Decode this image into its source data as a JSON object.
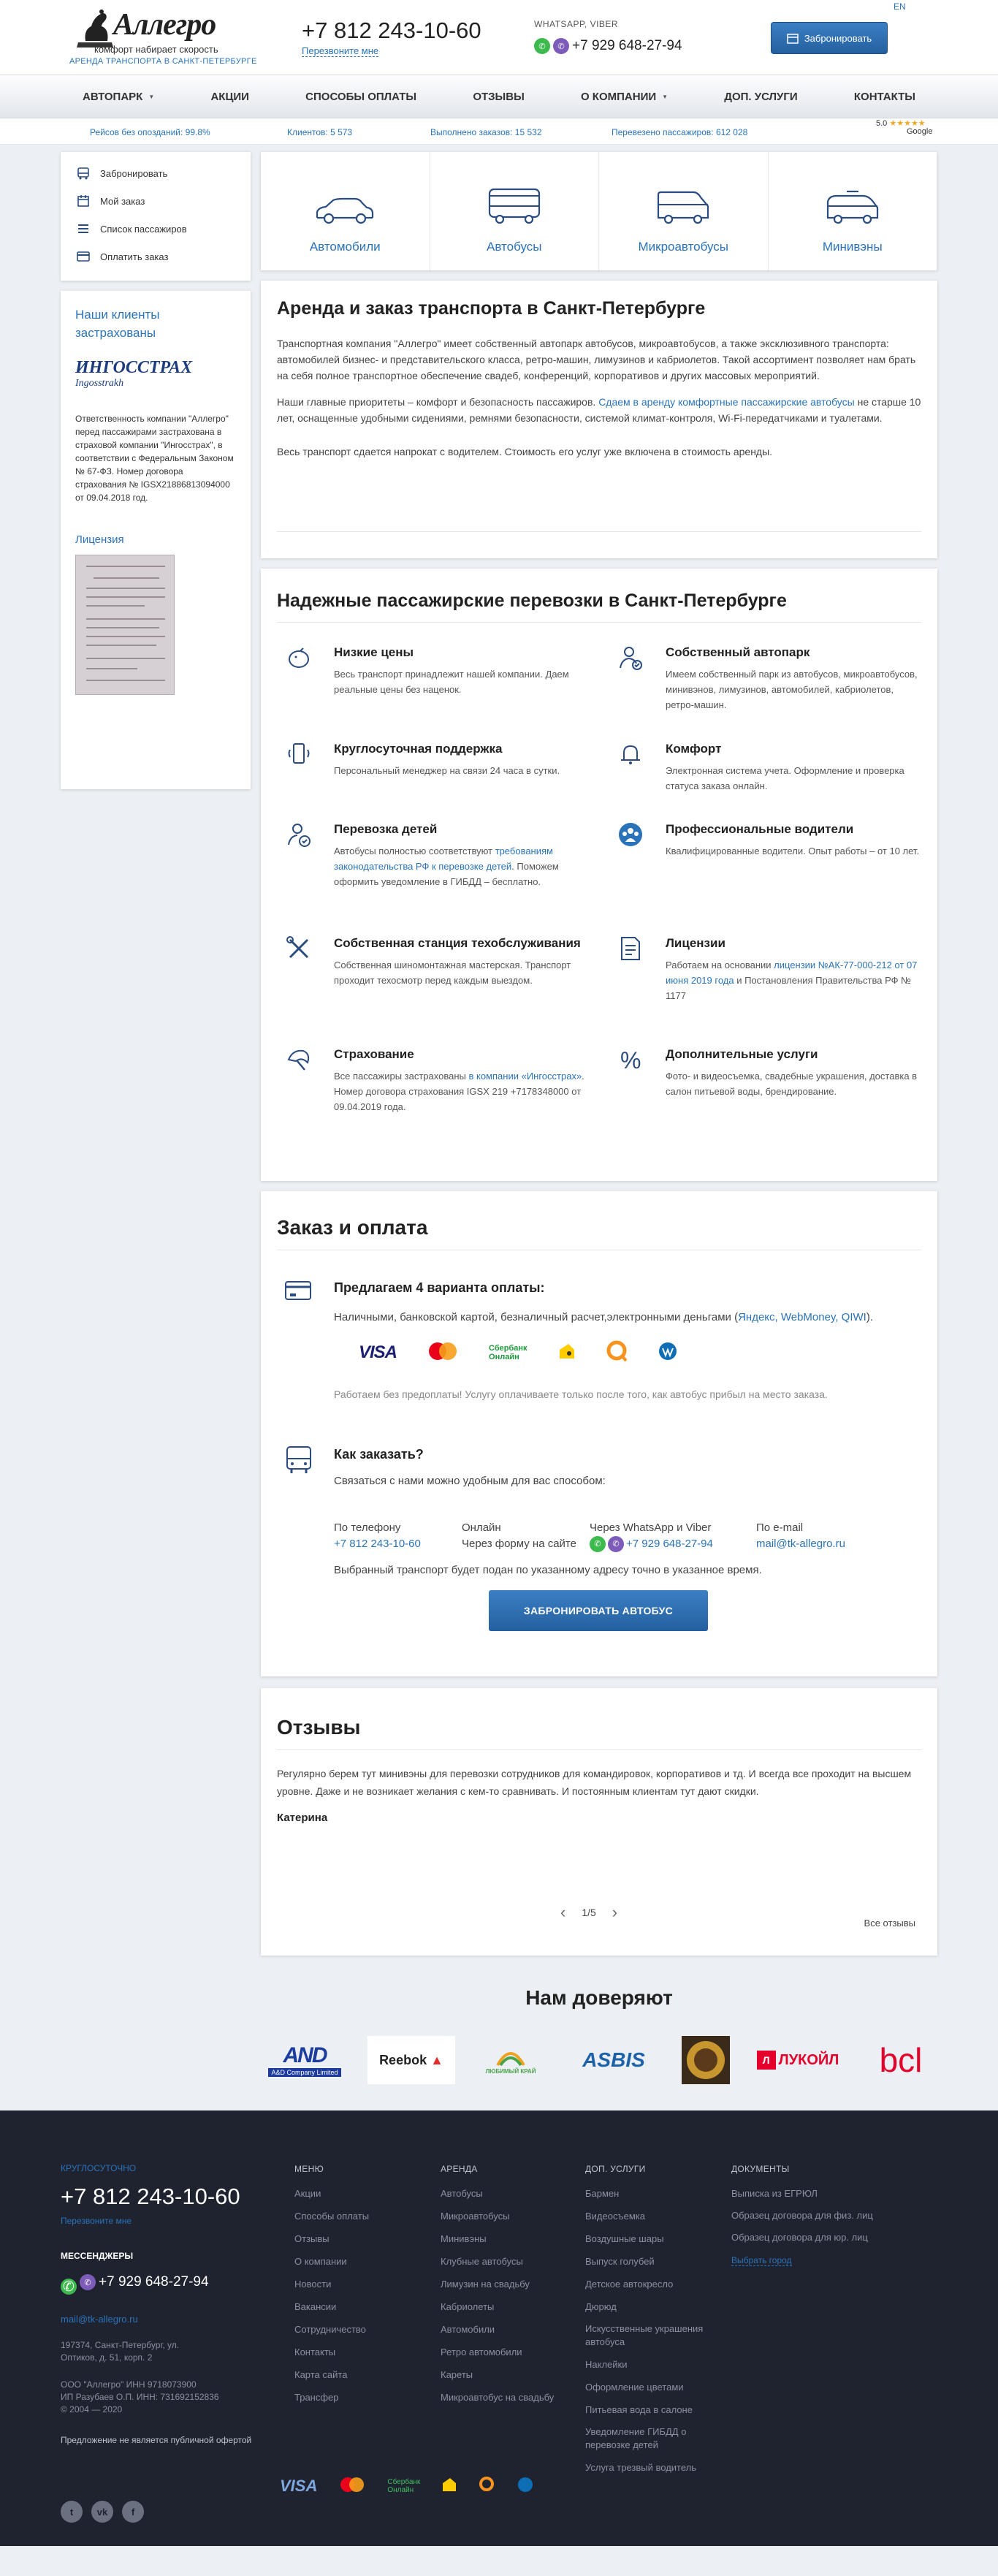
{
  "header": {
    "logo_name": "Аллегро",
    "logo_slogan": "комфорт набирает скорость",
    "logo_sub": "АРЕНДА ТРАНСПОРТА В САНКТ-ПЕТЕРБУРГЕ",
    "phone": "+7 812 243-10-60",
    "callback": "Перезвоните мне",
    "messenger_label": "WHATSAPP, VIBER",
    "messenger_phone": "+7 929 648-27-94",
    "book_button": "Забронировать",
    "lang": "EN"
  },
  "nav": [
    {
      "label": "АВТОПАРК",
      "dropdown": true
    },
    {
      "label": "АКЦИИ",
      "dropdown": false
    },
    {
      "label": "СПОСОБЫ ОПЛАТЫ",
      "dropdown": false
    },
    {
      "label": "ОТЗЫВЫ",
      "dropdown": false
    },
    {
      "label": "О КОМПАНИИ",
      "dropdown": true
    },
    {
      "label": "ДОП. УСЛУГИ",
      "dropdown": false
    },
    {
      "label": "КОНТАКТЫ",
      "dropdown": false
    }
  ],
  "stats": {
    "s1": "Рейсов без опозданий: 99.8%",
    "s2": "Клиентов: 5 573",
    "s3": "Выполнено заказов: 15 532",
    "s4": "Перевезено пассажиров: 612 028",
    "rating": "5.0",
    "stars": "★★★★★",
    "google": "Google"
  },
  "sidebar": {
    "items": [
      "Забронировать",
      "Мой заказ",
      "Список пассажиров",
      "Оплатить заказ"
    ],
    "clients_title": "Наши клиенты застрахованы",
    "ingos_name": "ИНГОССТРАХ",
    "ingos_sub": "Ingosstrakh",
    "insurance_text": "Ответственность компании \"Аллегро\" перед пассажирами застрахована в страховой компании \"Ингосстрах\", в соответствии с Федеральным Законом № 67-ФЗ. Номер договора страхования № IGSX21886813094000 от 09.04.2018 год.",
    "license_title": "Лицензия"
  },
  "types": [
    "Автомобили",
    "Автобусы",
    "Микроавтобусы",
    "Минивэны"
  ],
  "intro": {
    "title": "Аренда и заказ транспорта в Санкт-Петербурге",
    "p1": "Транспортная компания \"Аллегро\" имеет собственный автопарк автобусов, микроавтобусов, а также эксклюзивного транспорта: автомобилей бизнес- и представительского класса, ретро-машин, лимузинов и кабриолетов. Такой ассортимент позволяет нам брать на себя полное транспортное обеспечение свадеб, конференций, корпоративов и других массовых мероприятий.",
    "p2a": "Наши главные приоритеты – комфорт и безопасность пассажиров. ",
    "p2link": "Сдаем в аренду комфортные пассажирские автобусы",
    "p2b": " не старше 10 лет, оснащенные удобными сидениями, ремнями безопасности, системой климат-контроля, Wi-Fi-передатчиками и туалетами.",
    "p3": "Весь транспорт сдается напрокат с водителем. Стоимость его услуг уже включена в стоимость аренды."
  },
  "features": {
    "title": "Надежные пассажирские перевозки в Санкт-Петербурге",
    "items": [
      {
        "title": "Низкие цены",
        "text": "Весь транспорт принадлежит нашей компании. Даем реальные цены без наценок."
      },
      {
        "title": "Собственный автопарк",
        "text": "Имеем собственный парк из автобусов, микроавтобусов, минивэнов, лимузинов, автомобилей, кабриолетов, ретро-машин."
      },
      {
        "title": "Круглосуточная поддержка",
        "text": "Персональный менеджер на связи 24 часа в сутки."
      },
      {
        "title": "Комфорт",
        "text": "Электронная система учета. Оформление и проверка статуса заказа онлайн."
      },
      {
        "title": "Перевозка детей",
        "text_a": "Автобусы полностью соответствуют ",
        "link": "требованиям законодательства РФ к перевозке детей",
        "text_b": ". Поможем оформить уведомление в ГИБДД – бесплатно."
      },
      {
        "title": "Профессиональные водители",
        "text": "Квалифицированные водители. Опыт работы – от 10 лет."
      },
      {
        "title": "Собственная станция техобслуживания",
        "text": "Собственная шиномонтажная мастерская. Транспорт проходит техосмотр перед каждым выездом."
      },
      {
        "title": "Лицензии",
        "text_a": "Работаем на основании ",
        "link": "лицензии №АК-77-000-212 от 07 июня 2019 года",
        "text_b": " и Постановления Правительства РФ № 1177"
      },
      {
        "title": "Страхование",
        "text_a": "Все пассажиры застрахованы ",
        "link": "в компании «Ингосстрах»",
        "text_b": ". Номер договора страхования IGSX 219 +7178348000 от 09.04.2019 года."
      },
      {
        "title": "Дополнительные услуги",
        "text": "Фото- и видеосъемка, свадебные украшения, доставка в салон питьевой воды, брендирование."
      }
    ]
  },
  "order": {
    "title": "Заказ и оплата",
    "pay_title": "Предлагаем 4 варианта оплаты:",
    "pay_text": "Наличными, банковской картой, безналичный расчет,электронными деньгами (",
    "pay_links": "Яндекс, WebMoney, QIWI",
    "pay_text_end": ").",
    "pay_logos": [
      "VISA",
      "MasterCard",
      "Сбербанк Онлайн",
      "Яндекс.Деньги",
      "QIWI",
      "WebMoney"
    ],
    "prepay_note": "Работаем без предоплаты! Услугу оплачиваете только после того, как автобус прибыл на место заказа.",
    "how_title": "Как заказать?",
    "how_text": "Связаться с нами можно удобным для вас способом:",
    "c1_label": "По телефону",
    "c1_value": "+7 812 243-10-60",
    "c2_label": "Онлайн",
    "c2_value": "Через форму на сайте",
    "c3_label": "Через WhatsApp и Viber",
    "c3_value": "+7 929 648-27-94",
    "c4_label": "По e-mail",
    "c4_value": "mail@tk-allegro.ru",
    "delivery_note": "Выбранный транспорт будет подан по указанному адресу точно в указанное время.",
    "button": "ЗАБРОНИРОВАТЬ АВТОБУС"
  },
  "reviews": {
    "title": "Отзывы",
    "text": "Регулярно берем тут минивэны для перевозки сотрудников для командировок, корпоративов и тд. И всегда все проходит на высшем уровне. Даже и не возникает желания с кем-то сравнивать. И постоянным клиентам тут дают скидки.",
    "author": "Катерина",
    "pager": "1/5",
    "all": "Все отзывы"
  },
  "trust": {
    "title": "Нам доверяют",
    "logos": [
      "AND",
      "A&D Company Limited",
      "Reebok",
      "ЛЮБИМЫЙ КРАЙ",
      "ASBIS",
      "ЛУКОЙЛ",
      "bcl"
    ]
  },
  "footer": {
    "label": "КРУГЛОСУТОЧНО",
    "phone": "+7 812 243-10-60",
    "callback": "Перезвоните мне",
    "messengers_label": "МЕССЕНДЖЕРЫ",
    "messenger_phone": "+7 929 648-27-94",
    "mail": "mail@tk-allegro.ru",
    "address": "197374, Санкт-Петербург, ул. Оптиков, д. 51, корп. 2",
    "company1": "ООО \"Аллегро\" ИНН 9718073900",
    "company2": "ИП Разубаев О.П. ИНН: 731692152836",
    "years": "© 2004 — 2020",
    "offer_note": "Предложение не является публичной офертой",
    "menu_title": "МЕНЮ",
    "menu": [
      "Акции",
      "Способы оплаты",
      "Отзывы",
      "О компании",
      "Новости",
      "Вакансии",
      "Сотрудничество",
      "Контакты",
      "Карта сайта",
      "Трансфер"
    ],
    "rent_title": "АРЕНДА",
    "rent": [
      "Автобусы",
      "Микроавтобусы",
      "Минивэны",
      "Клубные автобусы",
      "Лимузин на свадьбу",
      "Кабриолеты",
      "Автомобили",
      "Ретро автомобили",
      "Кареты",
      "Микроавтобус на свадьбу"
    ],
    "extra_title": "ДОП. УСЛУГИ",
    "extra": [
      "Бармен",
      "Видеосъемка",
      "Воздушные шары",
      "Выпуск голубей",
      "Детское автокресло",
      "Дюрюд",
      "Искусственные украшения автобуса",
      "Наклейки",
      "Оформление цветами",
      "Питьевая вода в салоне",
      "Уведомление ГИБДД о перевозке детей",
      "Услуга трезвый водитель"
    ],
    "docs_title": "ДОКУМЕНТЫ",
    "docs": [
      "Выписка из ЕГРЮЛ",
      "Образец договора для физ. лиц",
      "Образец договора для юр. лиц"
    ],
    "choose_city": "Выбрать город",
    "pay_logos": [
      "VISA",
      "MasterCard",
      "Сбербанк Онлайн",
      "Яндекс",
      "QIWI",
      "WebMoney"
    ],
    "social": [
      "t",
      "vk",
      "f"
    ]
  },
  "colors": {
    "accent": "#2a73b8",
    "footer_bg": "#1f2330",
    "whatsapp": "#3dba4e",
    "viber": "#7d5cb9"
  }
}
